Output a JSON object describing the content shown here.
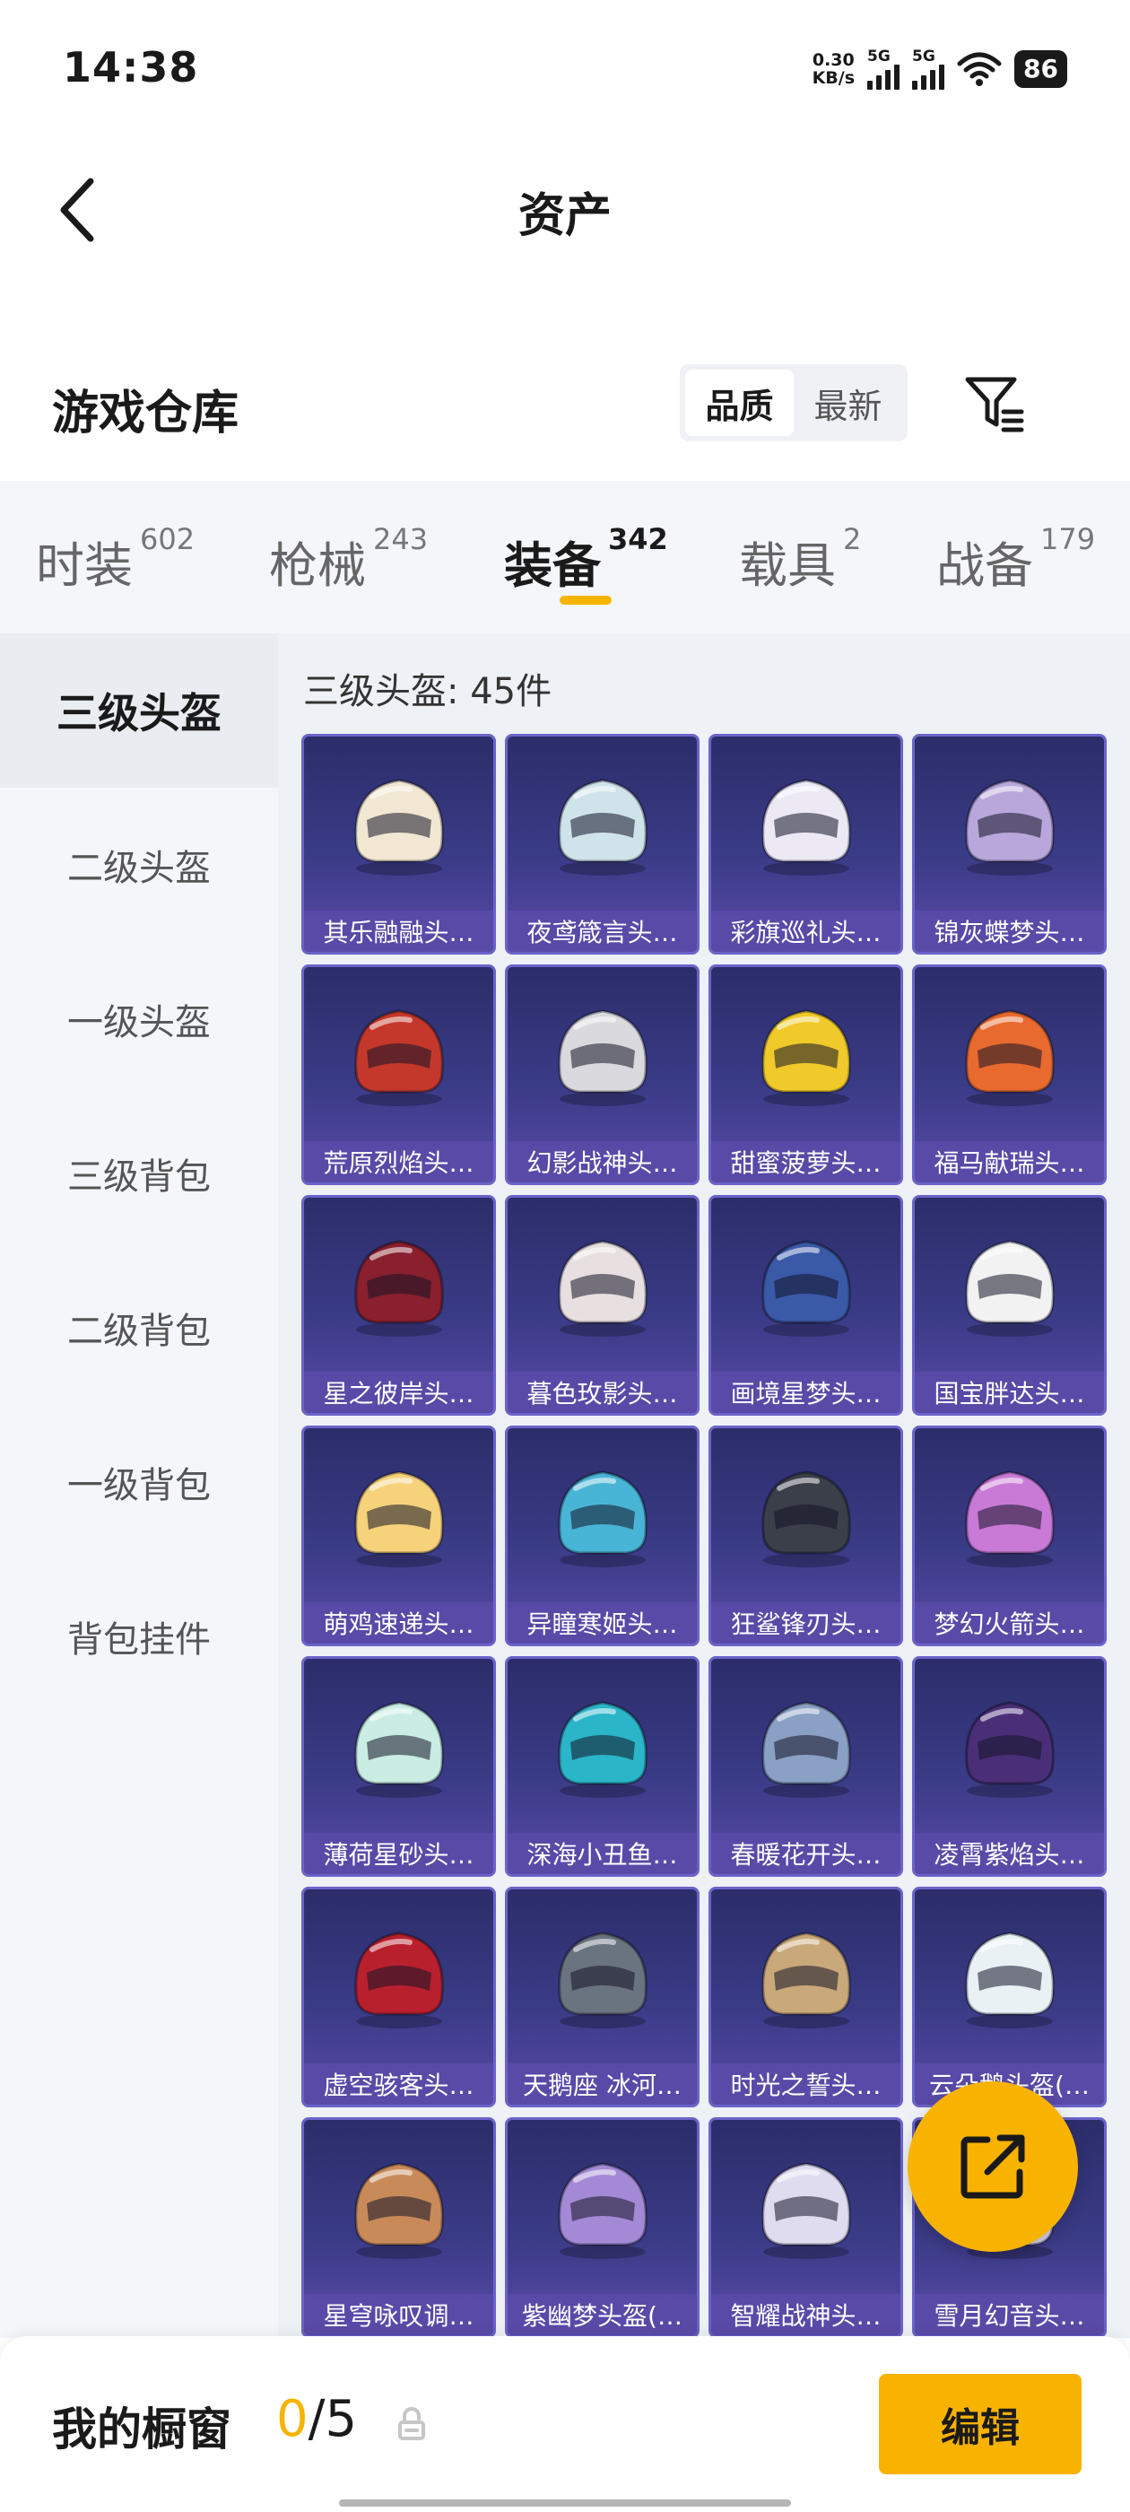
{
  "status_bar": {
    "time": "14:38",
    "net_speed_value": "0.30",
    "net_speed_unit": "KB/s",
    "signal1_label": "5G",
    "signal2_label": "5G",
    "battery": "86"
  },
  "header": {
    "title": "资产"
  },
  "warehouse": {
    "title": "游戏仓库",
    "sort_options": [
      "品质",
      "最新"
    ],
    "active_sort": "品质"
  },
  "category_tabs": [
    {
      "label": "时装",
      "count": "602"
    },
    {
      "label": "枪械",
      "count": "243"
    },
    {
      "label": "装备",
      "count": "342",
      "active": true
    },
    {
      "label": "载具",
      "count": "2"
    },
    {
      "label": "战备",
      "count": "179"
    }
  ],
  "sidebar": {
    "items": [
      "三级头盔",
      "二级头盔",
      "一级头盔",
      "三级背包",
      "二级背包",
      "一级背包",
      "背包挂件"
    ],
    "active": "三级头盔"
  },
  "section": {
    "title": "三级头盔: 45件"
  },
  "items": [
    {
      "name": "其乐融融头…",
      "color": "#f1e7d2"
    },
    {
      "name": "夜鸢箴言头…",
      "color": "#cfe3ea"
    },
    {
      "name": "彩旗巡礼头…",
      "color": "#ece9f5"
    },
    {
      "name": "锦灰蝶梦头…",
      "color": "#b9a7dc"
    },
    {
      "name": "荒原烈焰头…",
      "color": "#c4382b"
    },
    {
      "name": "幻影战神头…",
      "color": "#d9d9de"
    },
    {
      "name": "甜蜜菠萝头…",
      "color": "#f0c92a"
    },
    {
      "name": "福马献瑞头…",
      "color": "#e86a2e"
    },
    {
      "name": "星之彼岸头…",
      "color": "#8a1f2e"
    },
    {
      "name": "暮色玫影头…",
      "color": "#e8e0e0"
    },
    {
      "name": "画境星梦头…",
      "color": "#3a5aa8"
    },
    {
      "name": "国宝胖达头…",
      "color": "#f2f2f2"
    },
    {
      "name": "萌鸡速递头…",
      "color": "#f6d27a"
    },
    {
      "name": "异瞳寒姬头…",
      "color": "#49b5d6"
    },
    {
      "name": "狂鲨锋刃头…",
      "color": "#3a3f4a"
    },
    {
      "name": "梦幻火箭头…",
      "color": "#c97ad6"
    },
    {
      "name": "薄荷星砂头…",
      "color": "#c9ede3"
    },
    {
      "name": "深海小丑鱼…",
      "color": "#2ab5c8"
    },
    {
      "name": "春暖花开头…",
      "color": "#8aa0c4"
    },
    {
      "name": "凌霄紫焰头…",
      "color": "#4a2f78"
    },
    {
      "name": "虚空骇客头…",
      "color": "#b8202e"
    },
    {
      "name": "天鹅座 冰河…",
      "color": "#6a7480"
    },
    {
      "name": "时光之誓头…",
      "color": "#c9a87a"
    },
    {
      "name": "云朵鹅头盔(…",
      "color": "#e9f1f5"
    },
    {
      "name": "星穹咏叹调…",
      "color": "#c98a5a"
    },
    {
      "name": "紫幽梦头盔(…",
      "color": "#a48ad6"
    },
    {
      "name": "智耀战神头…",
      "color": "#e0dcf0"
    },
    {
      "name": "雪月幻音头…",
      "color": "#d8d2ea"
    }
  ],
  "bottom_bar": {
    "label": "我的橱窗",
    "current": "0",
    "total": "/5",
    "edit_label": "编辑"
  },
  "colors": {
    "accent": "#f8b300",
    "card_bg": "#3a3b86"
  }
}
